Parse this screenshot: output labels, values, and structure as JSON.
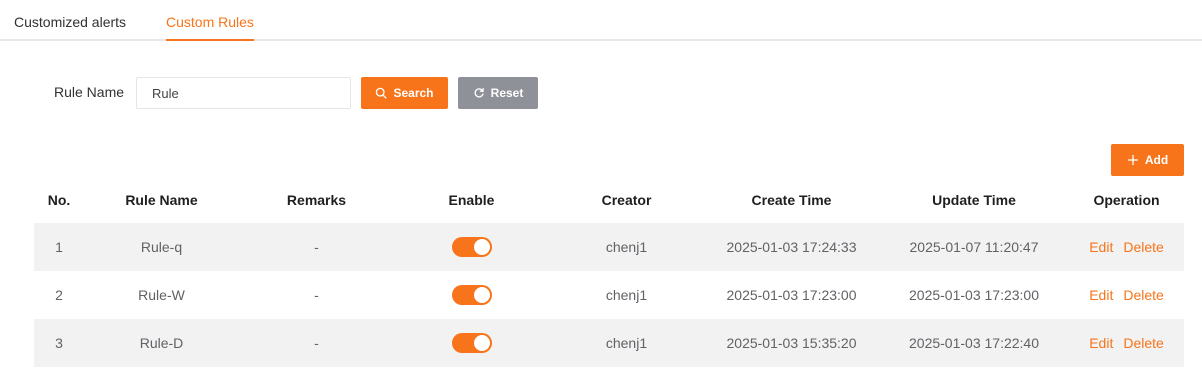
{
  "tabs": [
    {
      "label": "Customized alerts",
      "active": false
    },
    {
      "label": "Custom Rules",
      "active": true
    }
  ],
  "filter": {
    "label": "Rule Name",
    "value": "Rule",
    "search_label": "Search",
    "reset_label": "Reset"
  },
  "add_label": "Add",
  "table": {
    "headers": [
      "No.",
      "Rule Name",
      "Remarks",
      "Enable",
      "Creator",
      "Create Time",
      "Update Time",
      "Operation"
    ],
    "rows": [
      {
        "no": "1",
        "name": "Rule-q",
        "remarks": "-",
        "enabled": true,
        "creator": "chenj1",
        "create_time": "2025-01-03 17:24:33",
        "update_time": "2025-01-07 11:20:47",
        "edit": "Edit",
        "delete": "Delete"
      },
      {
        "no": "2",
        "name": "Rule-W",
        "remarks": "-",
        "enabled": true,
        "creator": "chenj1",
        "create_time": "2025-01-03 17:23:00",
        "update_time": "2025-01-03 17:23:00",
        "edit": "Edit",
        "delete": "Delete"
      },
      {
        "no": "3",
        "name": "Rule-D",
        "remarks": "-",
        "enabled": true,
        "creator": "chenj1",
        "create_time": "2025-01-03 15:35:20",
        "update_time": "2025-01-03 17:22:40",
        "edit": "Edit",
        "delete": "Delete"
      }
    ]
  },
  "colors": {
    "accent": "#f7741a",
    "reset_button": "#8e9197",
    "row_stripe": "#f2f2f2"
  },
  "icons": {
    "search": "search-icon",
    "reset": "refresh-icon",
    "add": "plus-icon"
  }
}
